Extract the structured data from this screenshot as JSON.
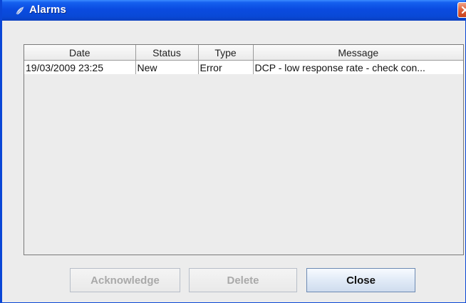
{
  "window": {
    "title": "Alarms"
  },
  "alarms_table": {
    "columns": [
      "Date",
      "Status",
      "Type",
      "Message"
    ],
    "rows": [
      {
        "date": "19/03/2009 23:25",
        "status": "New",
        "type": "Error",
        "message": "DCP - low response rate - check con..."
      }
    ]
  },
  "buttons": {
    "acknowledge_label": "Acknowledge",
    "acknowledge_enabled": false,
    "delete_label": "Delete",
    "delete_enabled": false,
    "close_label": "Close",
    "close_enabled": true
  },
  "colors": {
    "titlebar": "#0a4be0",
    "close_button": "#e0643e",
    "window_background": "#ececec"
  }
}
